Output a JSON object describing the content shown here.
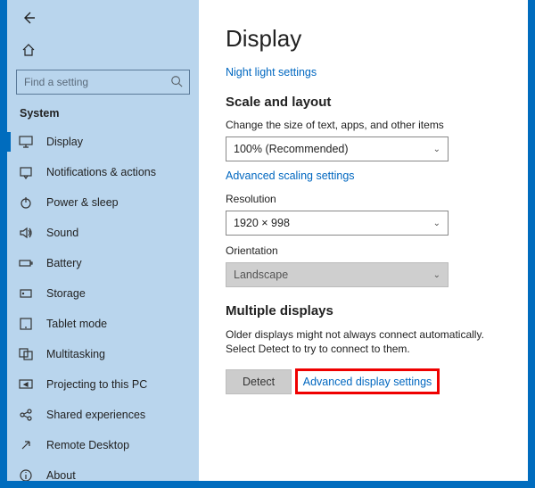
{
  "sidebar": {
    "search_placeholder": "Find a setting",
    "section_label": "System",
    "items": [
      {
        "label": "Display",
        "icon": "display",
        "active": true
      },
      {
        "label": "Notifications & actions",
        "icon": "notify"
      },
      {
        "label": "Power & sleep",
        "icon": "power"
      },
      {
        "label": "Sound",
        "icon": "sound"
      },
      {
        "label": "Battery",
        "icon": "battery"
      },
      {
        "label": "Storage",
        "icon": "storage"
      },
      {
        "label": "Tablet mode",
        "icon": "tablet"
      },
      {
        "label": "Multitasking",
        "icon": "multitask"
      },
      {
        "label": "Projecting to this PC",
        "icon": "project"
      },
      {
        "label": "Shared experiences",
        "icon": "shared"
      },
      {
        "label": "Remote Desktop",
        "icon": "remote"
      },
      {
        "label": "About",
        "icon": "about"
      }
    ]
  },
  "main": {
    "title": "Display",
    "night_link": "Night light settings",
    "scale_heading": "Scale and layout",
    "scale_label": "Change the size of text, apps, and other items",
    "scale_value": "100% (Recommended)",
    "adv_scaling_link": "Advanced scaling settings",
    "resolution_label": "Resolution",
    "resolution_value": "1920 × 998",
    "orientation_label": "Orientation",
    "orientation_value": "Landscape",
    "multiple_heading": "Multiple displays",
    "multiple_desc": "Older displays might not always connect automatically. Select Detect to try to connect to them.",
    "detect_btn": "Detect",
    "adv_display_link": "Advanced display settings"
  }
}
